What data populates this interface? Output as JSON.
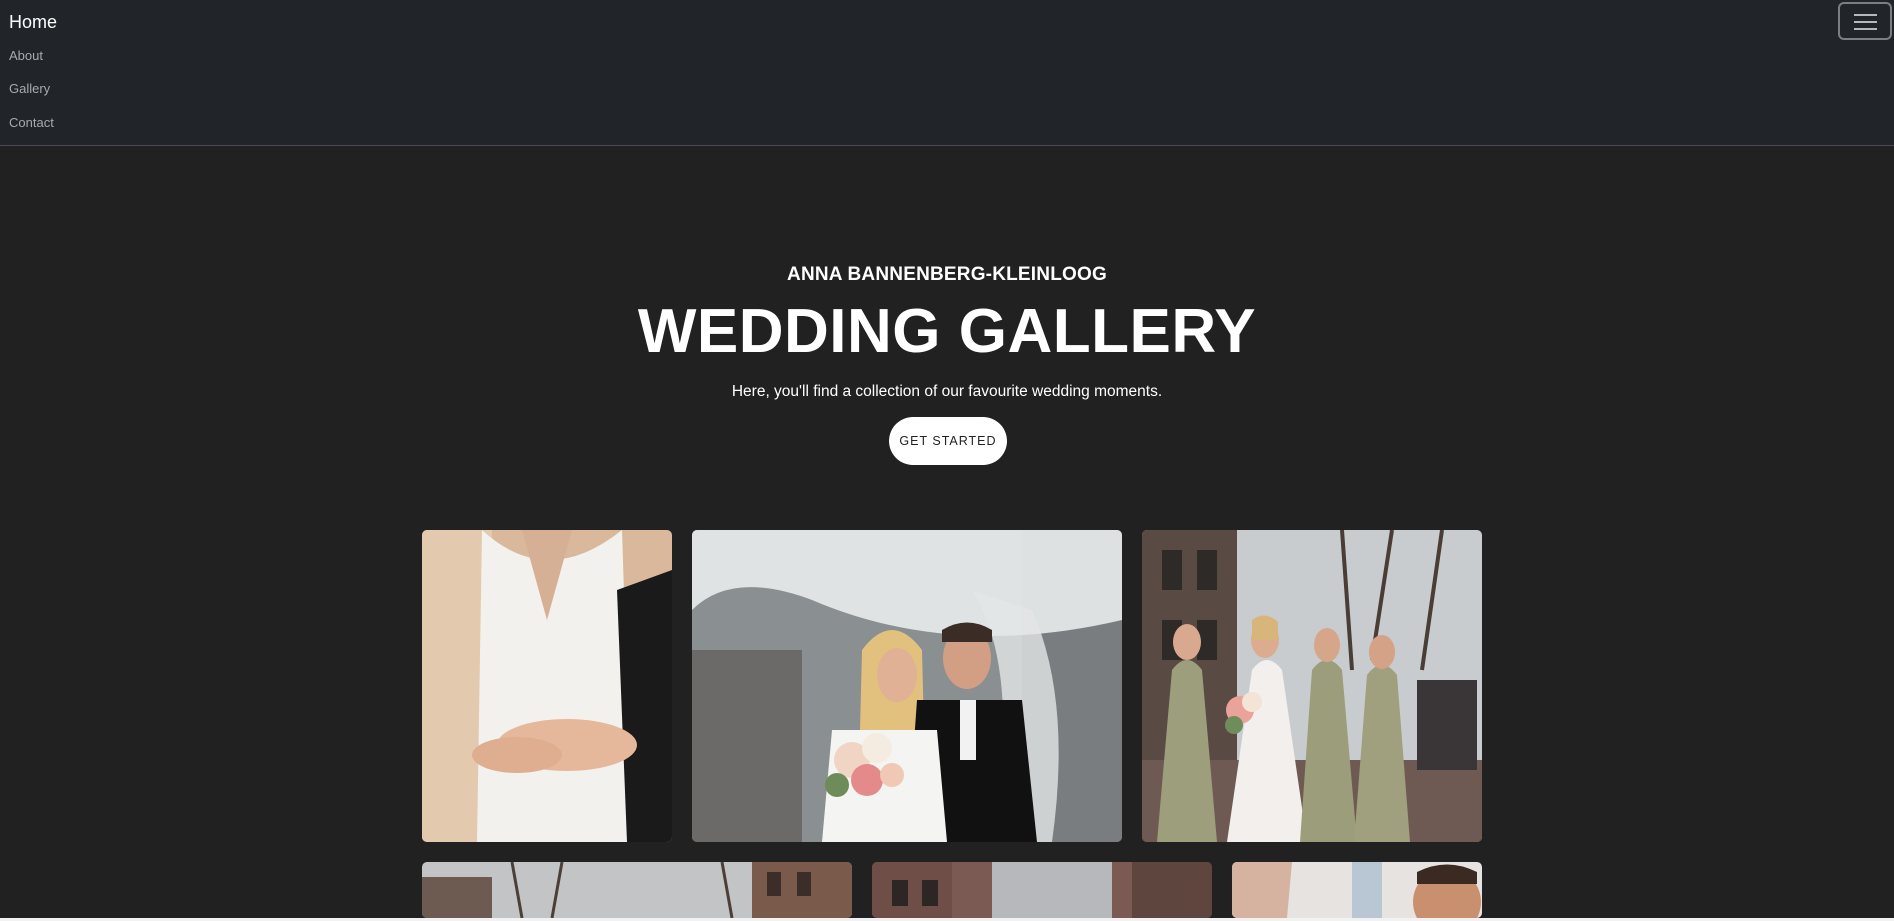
{
  "nav": {
    "brand": "Home",
    "links": [
      "About",
      "Gallery",
      "Contact"
    ],
    "menu_icon": "hamburger-menu-icon"
  },
  "hero": {
    "eyebrow": "ANNA BANNENBERG-KLEINLOOG",
    "title": "WEDDING GALLERY",
    "subtitle": "Here, you'll find a collection of our favourite wedding moments.",
    "cta_label": "GET STARTED"
  },
  "colors": {
    "page_bg": "#212121",
    "nav_bg": "#212529",
    "button_bg": "#ffffff",
    "text": "#ffffff"
  }
}
